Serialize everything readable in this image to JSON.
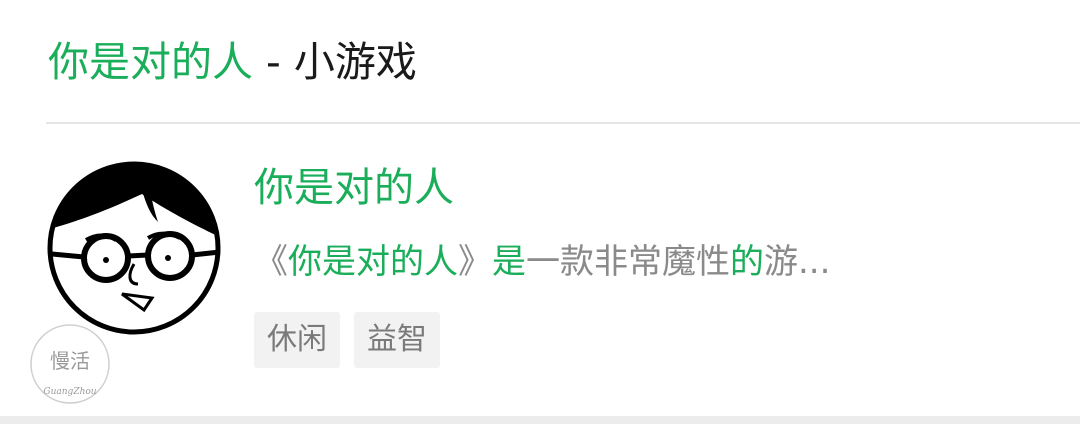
{
  "header": {
    "game_name": "你是对的人",
    "suffix": " - 小游戏"
  },
  "game": {
    "title": "你是对的人",
    "description_parts": [
      "《",
      "你是对的人",
      "》",
      "是",
      "一款非常魔性",
      "的",
      "游..."
    ],
    "tags": [
      "休闲",
      "益智"
    ],
    "avatar_icon": "cartoon-face-with-glasses-icon"
  },
  "watermark": {
    "text": "慢活",
    "script": "GuangZhou"
  },
  "colors": {
    "accent_green": "#1aad5a",
    "text_dark": "#1a1a1a",
    "text_gray": "#8a8a8a",
    "tag_bg": "#f2f2f2"
  }
}
